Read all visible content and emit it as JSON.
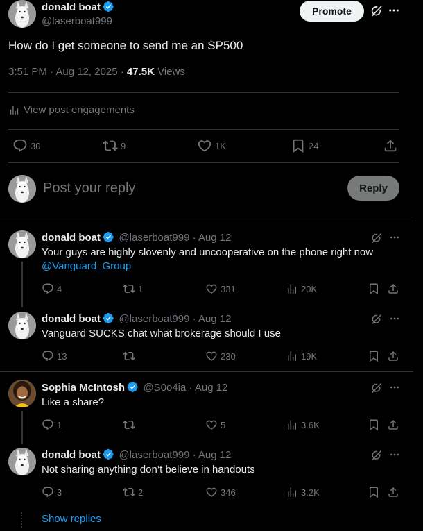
{
  "main_post": {
    "author_name": "donald boat",
    "author_handle": "@laserboat999",
    "promote_label": "Promote",
    "text": "How do I get someone to send me an SP500",
    "timestamp": "3:51 PM · Aug 12, 2025 · ",
    "views_count": "47.5K",
    "views_label": " Views",
    "engagements_label": "View post engagements",
    "stats": {
      "replies": "30",
      "reposts": "9",
      "likes": "1K",
      "bookmarks": "24"
    }
  },
  "reply_box": {
    "placeholder": "Post your reply",
    "button_label": "Reply"
  },
  "replies": [
    {
      "author_name": "donald boat",
      "meta": "@laserboat999 · Aug 12",
      "text": "Your guys are highly slovenly and uncooperative on the phone right now",
      "mention": "@Vanguard_Group",
      "replies": "4",
      "reposts": "1",
      "likes": "331",
      "views": "20K"
    },
    {
      "author_name": "donald boat",
      "meta": "@laserboat999 · Aug 12",
      "text": "Vanguard SUCKS chat what brokerage should I use",
      "replies": "13",
      "reposts": "",
      "likes": "230",
      "views": "19K"
    },
    {
      "author_name": "Sophia McIntosh",
      "meta": "@S0o4ia · Aug 12",
      "text": "Like a share?",
      "replies": "1",
      "reposts": "",
      "likes": "5",
      "views": "3.6K"
    },
    {
      "author_name": "donald boat",
      "meta": "@laserboat999 · Aug 12",
      "text": "Not sharing anything don’t believe in handouts",
      "replies": "3",
      "reposts": "2",
      "likes": "346",
      "views": "3.2K"
    }
  ],
  "show_replies_label": "Show replies",
  "colors": {
    "background": "#000000",
    "text": "#e7e9ea",
    "muted": "#71767b",
    "accent": "#1d9bf0",
    "divider": "#2f3336"
  }
}
